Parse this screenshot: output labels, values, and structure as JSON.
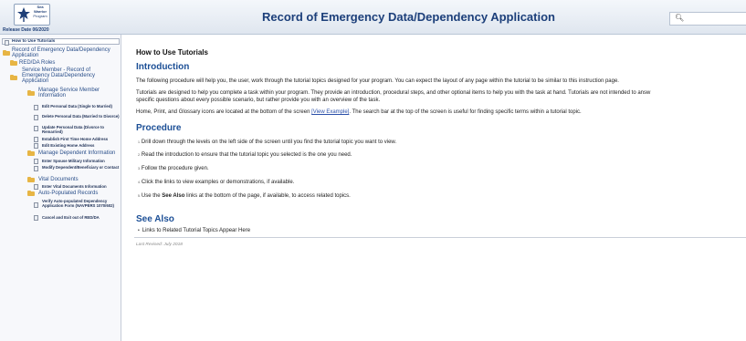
{
  "header": {
    "logo_line1": "Sea Warrior",
    "logo_line2": "Program",
    "release_date": "Release Date 06/2020",
    "title": "Record of Emergency Data/Dependency Application",
    "search_placeholder": ""
  },
  "sidebar": {
    "items": [
      {
        "label": "How to Use Tutorials",
        "kind": "page"
      },
      {
        "label": "Record of Emergency Data/Dependency Application",
        "kind": "folder"
      },
      {
        "label": "RED/DA Roles",
        "kind": "folder"
      },
      {
        "label": "Service Member - Record of Emergency Data/Dependency Application",
        "kind": "folder"
      },
      {
        "label": "Manage Service Member Information",
        "kind": "folder"
      },
      {
        "label": "Edit Personal Data (Single to Married)",
        "kind": "page"
      },
      {
        "label": "Delete Personal Data (Married to Divorce)",
        "kind": "page"
      },
      {
        "label": "Update Personal Data (Divorce to Remarried)",
        "kind": "page"
      },
      {
        "label": "Establish First Time Home Address",
        "kind": "page"
      },
      {
        "label": "Edit Existing Home Address",
        "kind": "page"
      },
      {
        "label": "Manage Dependent Information",
        "kind": "folder"
      },
      {
        "label": "Enter Spouse Military Information",
        "kind": "page"
      },
      {
        "label": "Modify Dependent/Beneficiary or Contact",
        "kind": "page"
      },
      {
        "label": "Vital Documents",
        "kind": "folder"
      },
      {
        "label": "Enter Vital Documents Information",
        "kind": "page"
      },
      {
        "label": "Auto-Populated Records",
        "kind": "folder"
      },
      {
        "label": "Verify Auto-populated Dependency Application Form (NAVPERS 1070/602)",
        "kind": "page"
      },
      {
        "label": "Cancel and Exit out of RED/DA",
        "kind": "page"
      }
    ]
  },
  "main": {
    "page_title": "How to Use Tutorials",
    "intro_heading": "Introduction",
    "intro_p1": "The following procedure will help you, the user, work through the tutorial topics designed for your program. You can expect the layout of any page within the tutorial to be similar to this instruction page.",
    "intro_p2a": "Tutorials are designed to help you complete a task within your program. They provide an introduction, procedural steps, and other optional items to help you with the task at hand. Tutorials are not intended to answ",
    "intro_p2b": "specific questions about every possible scenario, but rather provide you with an overview of the task.",
    "intro_p3_pre": "Home, Print, and Glossary icons are located at the bottom of the screen ",
    "intro_p3_link": "[View Example]",
    "intro_p3_post": ". The search bar at the top of the screen is useful for finding specific terms within a tutorial topic.",
    "procedure_heading": "Procedure",
    "steps": [
      {
        "num": "1.",
        "text": "Drill down through the levels on the left side of the screen until you find the tutorial topic you want to view."
      },
      {
        "num": "2.",
        "text": "Read the introduction to ensure that the tutorial topic you selected is the one you need."
      },
      {
        "num": "3.",
        "text": "Follow the procedure given."
      },
      {
        "num": "4.",
        "text": "Click the links to view examples or demonstrations, if available."
      },
      {
        "num": "5.",
        "pre": "Use the ",
        "bold": "See Also",
        "post": " links at the bottom of the page, if available, to access related topics."
      }
    ],
    "see_also_heading": "See Also",
    "see_also_bullet": "•",
    "see_also_item": "Links to Related Tutorial Topics Appear Here",
    "last_revised": "Last Revised: July 2018"
  }
}
